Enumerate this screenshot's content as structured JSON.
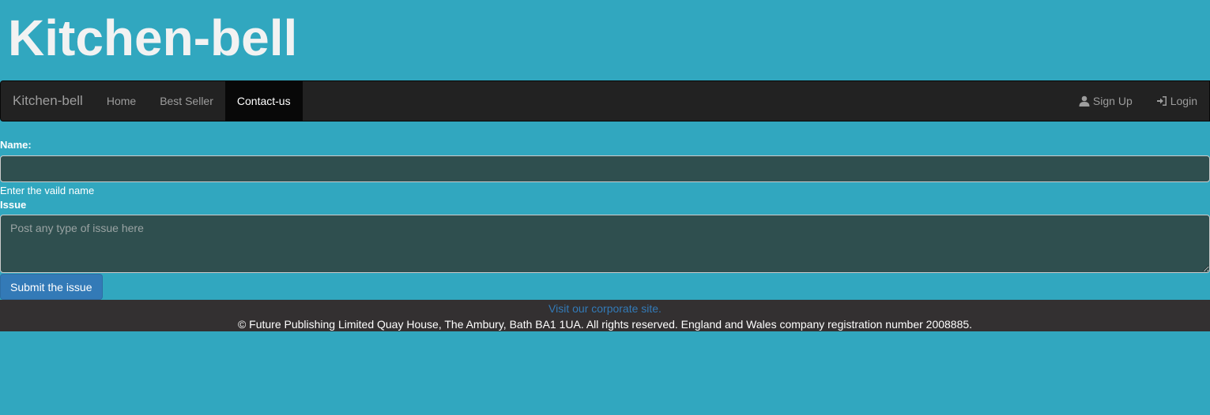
{
  "header": {
    "title": "Kitchen-bell"
  },
  "navbar": {
    "brand": "Kitchen-bell",
    "items": [
      {
        "label": "Home",
        "active": false
      },
      {
        "label": "Best Seller",
        "active": false
      },
      {
        "label": "Contact-us",
        "active": true
      }
    ],
    "right_items": [
      {
        "label": "Sign Up",
        "icon": "user-icon"
      },
      {
        "label": "Login",
        "icon": "login-icon"
      }
    ]
  },
  "form": {
    "name_label": "Name:",
    "name_value": "",
    "name_hint": "Enter the vaild name",
    "issue_label": "Issue",
    "issue_placeholder": "Post any type of issue here",
    "submit_label": "Submit the issue"
  },
  "footer": {
    "link_text": "Visit our corporate site.",
    "copyright": "© Future Publishing Limited Quay House, The Ambury, Bath BA1 1UA. All rights reserved. England and Wales company registration number 2008885."
  },
  "colors": {
    "background": "#31a7bf",
    "navbar": "#222222",
    "input_bg": "#2f4f4f",
    "button": "#337ab7",
    "footer": "#333031"
  }
}
